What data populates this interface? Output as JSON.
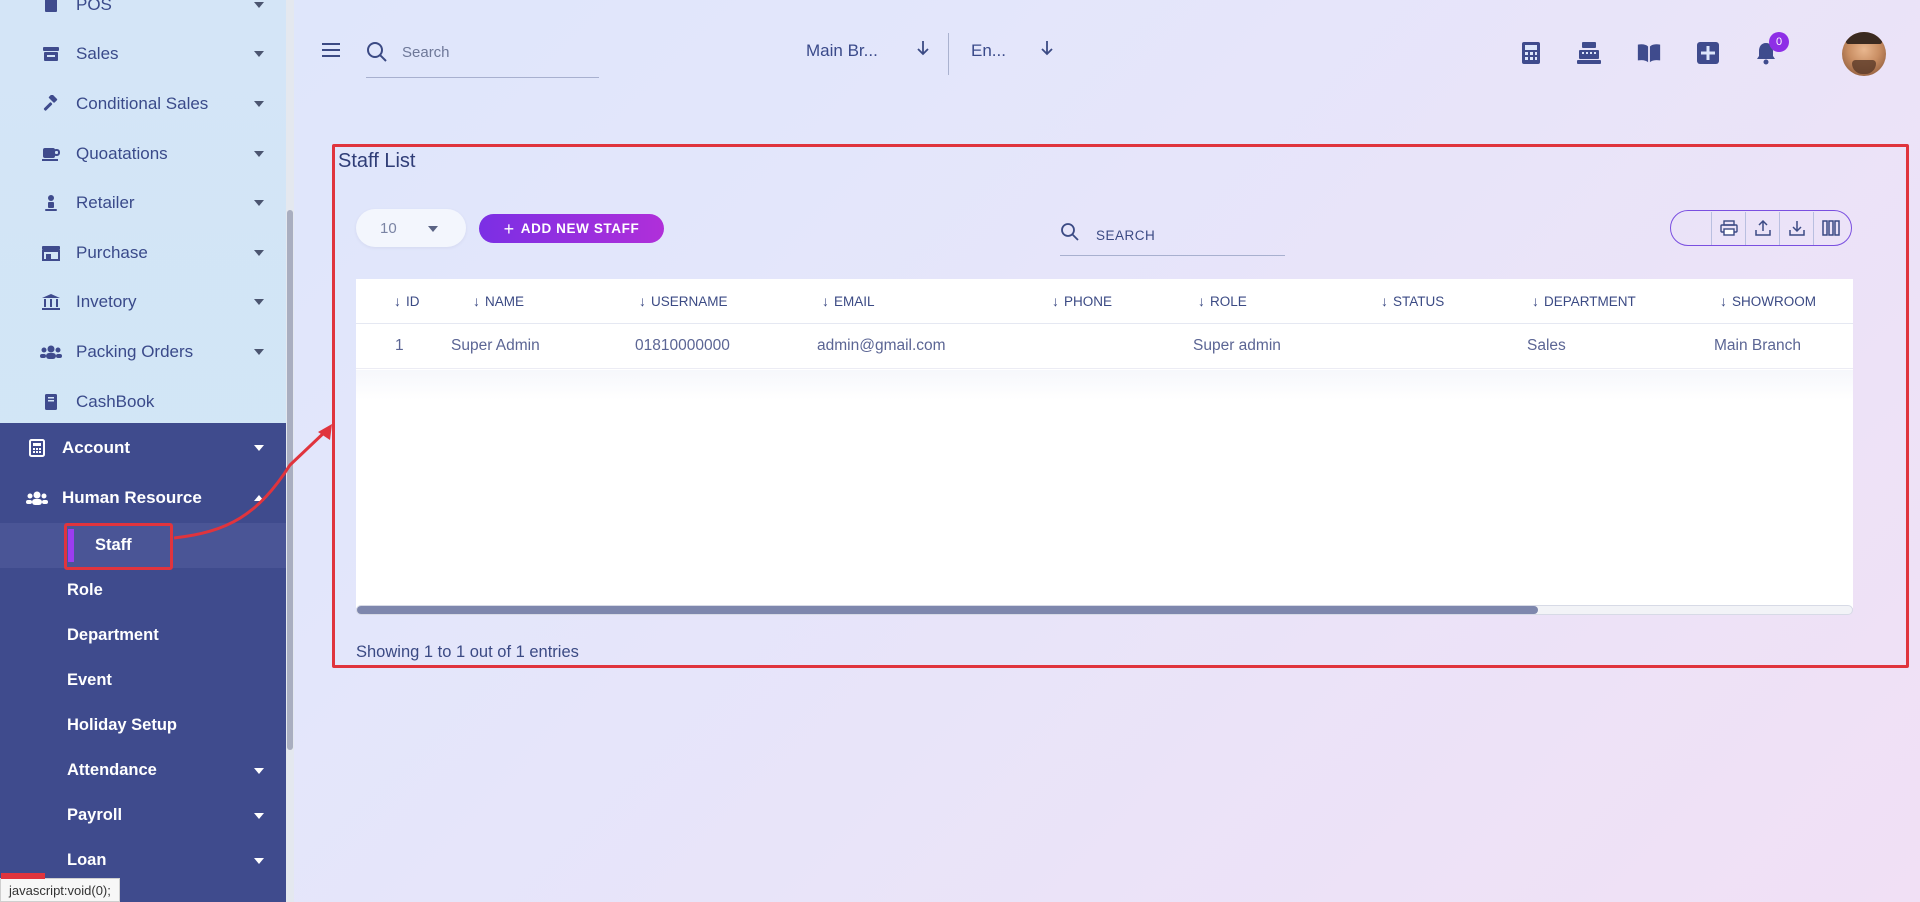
{
  "sidebar": {
    "top_items": [
      {
        "label": "POS",
        "icon": "pos-icon",
        "has_caret": true
      },
      {
        "label": "Sales",
        "icon": "store-icon",
        "has_caret": true
      },
      {
        "label": "Conditional Sales",
        "icon": "gavel-icon",
        "has_caret": true
      },
      {
        "label": "Quoatations",
        "icon": "mug-icon",
        "has_caret": true
      },
      {
        "label": "Retailer",
        "icon": "person-icon",
        "has_caret": true
      },
      {
        "label": "Purchase",
        "icon": "storefront-icon",
        "has_caret": true
      },
      {
        "label": "Invetory",
        "icon": "bank-icon",
        "has_caret": true
      },
      {
        "label": "Packing Orders",
        "icon": "users-icon",
        "has_caret": true
      },
      {
        "label": "CashBook",
        "icon": "book-icon",
        "has_caret": false
      }
    ],
    "dark_items": [
      {
        "label": "Account",
        "icon": "calculator-icon"
      },
      {
        "label": "Human Resource",
        "icon": "users-icon"
      }
    ],
    "sub_items": [
      {
        "label": "Staff",
        "active": true,
        "has_caret": false
      },
      {
        "label": "Role",
        "has_caret": false
      },
      {
        "label": "Department",
        "has_caret": false
      },
      {
        "label": "Event",
        "has_caret": false
      },
      {
        "label": "Holiday Setup",
        "has_caret": false
      },
      {
        "label": "Attendance",
        "has_caret": true
      },
      {
        "label": "Payroll",
        "has_caret": true
      },
      {
        "label": "Loan",
        "has_caret": true
      }
    ],
    "status_tip": "javascript:void(0);"
  },
  "topbar": {
    "search_placeholder": "Search",
    "branch_select": "Main Br...",
    "language_select": "En...",
    "icons": [
      "calculator-icon",
      "cash-register-icon",
      "book-open-icon",
      "plus-square-icon",
      "bell-icon"
    ],
    "notification_count": "0"
  },
  "main": {
    "title": "Staff List",
    "per_page": "10",
    "add_button": "ADD NEW STAFF",
    "search_placeholder": "SEARCH",
    "tools": [
      "print-icon",
      "upload-icon",
      "download-icon",
      "columns-icon"
    ],
    "columns": [
      "ID",
      "NAME",
      "USERNAME",
      "EMAIL",
      "PHONE",
      "ROLE",
      "STATUS",
      "DEPARTMENT",
      "SHOWROOM"
    ],
    "rows": [
      {
        "id": "1",
        "name": "Super Admin",
        "username": "01810000000",
        "email": "admin@gmail.com",
        "phone": "",
        "role": "Super admin",
        "status": "",
        "department": "Sales",
        "showroom": "Main Branch"
      }
    ],
    "footer": "Showing 1 to 1 out of 1 entries",
    "horizontal_scroll_fraction": 0.79
  },
  "colors": {
    "sidebar_dark": "#3f4b8d",
    "accent_purple": "#8e2fe6",
    "highlight_red": "#e0343d"
  }
}
